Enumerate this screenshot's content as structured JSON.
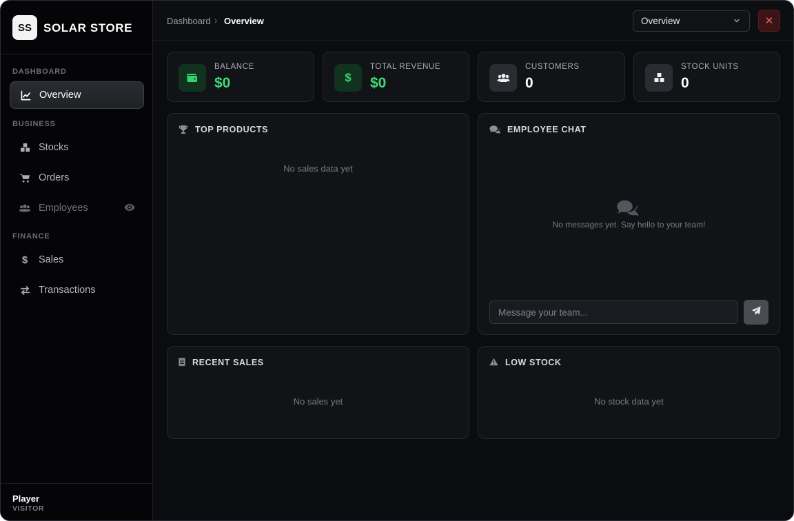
{
  "brand": {
    "logo": "SS",
    "name": "SOLAR STORE"
  },
  "sidebar": {
    "sections": [
      {
        "label": "DASHBOARD"
      },
      {
        "label": "BUSINESS"
      },
      {
        "label": "FINANCE"
      }
    ],
    "items": [
      {
        "label": "Overview",
        "icon": "chart-line-icon",
        "active": true
      },
      {
        "label": "Stocks",
        "icon": "boxes-icon"
      },
      {
        "label": "Orders",
        "icon": "cart-icon"
      },
      {
        "label": "Employees",
        "icon": "users-icon",
        "disabled": true,
        "badge_icon": "eye-icon"
      },
      {
        "label": "Sales",
        "icon": "dollar-icon"
      },
      {
        "label": "Transactions",
        "icon": "exchange-icon"
      }
    ]
  },
  "user": {
    "name": "Player",
    "role": "VISITOR"
  },
  "header": {
    "breadcrumb": [
      "Dashboard",
      "Overview"
    ],
    "select_value": "Overview"
  },
  "stats": [
    {
      "label": "BALANCE",
      "value": "$0",
      "icon": "wallet-icon",
      "color": "#3ddc78"
    },
    {
      "label": "TOTAL REVENUE",
      "value": "$0",
      "icon": "dollar-icon",
      "color": "#3ddc78"
    },
    {
      "label": "CUSTOMERS",
      "value": "0",
      "icon": "users-icon",
      "color": "#ffffff"
    },
    {
      "label": "STOCK UNITS",
      "value": "0",
      "icon": "boxes-icon",
      "color": "#ffffff"
    }
  ],
  "panels": {
    "top_products": {
      "title": "TOP PRODUCTS",
      "empty": "No sales data yet"
    },
    "employee_chat": {
      "title": "EMPLOYEE CHAT",
      "empty": "No messages yet. Say hello to your team!",
      "input_placeholder": "Message your team..."
    },
    "recent_sales": {
      "title": "RECENT SALES",
      "empty": "No sales yet"
    },
    "low_stock": {
      "title": "LOW STOCK",
      "empty": "No stock data yet"
    }
  },
  "colors": {
    "accent_green": "#3ddc78",
    "danger": "#ff5a5f",
    "background": "#0b0c10"
  }
}
